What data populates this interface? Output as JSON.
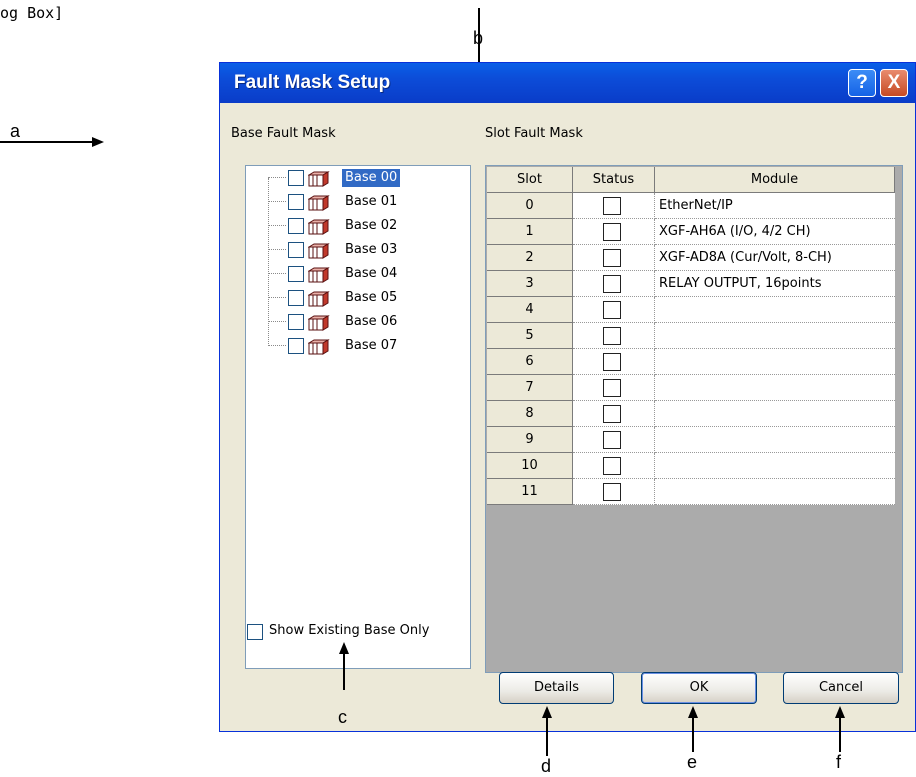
{
  "doc": {
    "caption_fragment": "og Box]"
  },
  "annotations": {
    "a": "a",
    "b": "b",
    "c": "c",
    "d": "d",
    "e": "e",
    "f": "f"
  },
  "dialog": {
    "title": "Fault Mask Setup",
    "help_label": "?",
    "close_label": "X",
    "base_section_label": "Base Fault Mask",
    "slot_section_label": "Slot Fault Mask",
    "bases": [
      {
        "label": "Base 00",
        "selected": true
      },
      {
        "label": "Base 01",
        "selected": false
      },
      {
        "label": "Base 02",
        "selected": false
      },
      {
        "label": "Base 03",
        "selected": false
      },
      {
        "label": "Base 04",
        "selected": false
      },
      {
        "label": "Base 05",
        "selected": false
      },
      {
        "label": "Base 06",
        "selected": false
      },
      {
        "label": "Base 07",
        "selected": false
      }
    ],
    "table": {
      "headers": {
        "slot": "Slot",
        "status": "Status",
        "module": "Module"
      },
      "rows": [
        {
          "slot": "0",
          "module": "EtherNet/IP"
        },
        {
          "slot": "1",
          "module": "XGF-AH6A (I/O, 4/2 CH)"
        },
        {
          "slot": "2",
          "module": "XGF-AD8A (Cur/Volt, 8-CH)"
        },
        {
          "slot": "3",
          "module": "RELAY OUTPUT, 16points"
        },
        {
          "slot": "4",
          "module": ""
        },
        {
          "slot": "5",
          "module": ""
        },
        {
          "slot": "6",
          "module": ""
        },
        {
          "slot": "7",
          "module": ""
        },
        {
          "slot": "8",
          "module": ""
        },
        {
          "slot": "9",
          "module": ""
        },
        {
          "slot": "10",
          "module": ""
        },
        {
          "slot": "11",
          "module": ""
        }
      ]
    },
    "show_existing_label": "Show Existing Base Only",
    "buttons": {
      "details": "Details",
      "ok": "OK",
      "cancel": "Cancel"
    }
  },
  "colors": {
    "titlebar": "#0A5FE8",
    "dialog_bg": "#ECE9D8",
    "selection": "#316AC5"
  }
}
